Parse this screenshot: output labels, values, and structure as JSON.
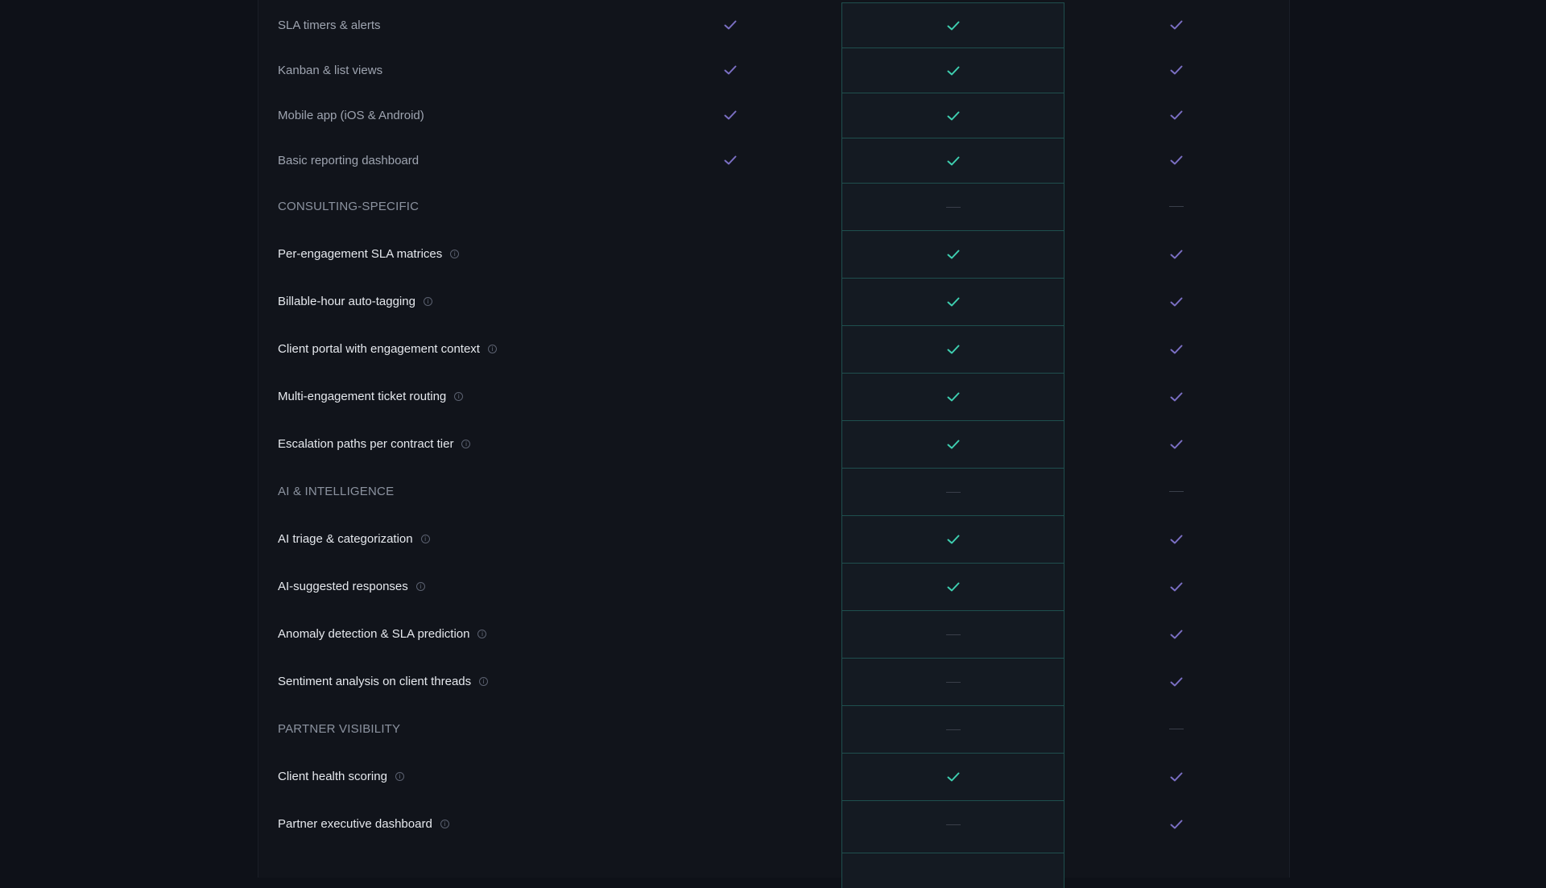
{
  "colors": {
    "accent_check": "#3ecfb0",
    "muted_check": "#7b6fc4",
    "highlight_border": "#1f4f4e"
  },
  "rows": [
    {
      "type": "basic",
      "label": "SLA timers & alerts",
      "info": false,
      "c1": "check",
      "c2": "check",
      "c3": "check"
    },
    {
      "type": "basic",
      "label": "Kanban & list views",
      "info": false,
      "c1": "check",
      "c2": "check",
      "c3": "check"
    },
    {
      "type": "basic",
      "label": "Mobile app (iOS & Android)",
      "info": false,
      "c1": "check",
      "c2": "check",
      "c3": "check"
    },
    {
      "type": "basic",
      "label": "Basic reporting dashboard",
      "info": false,
      "c1": "check",
      "c2": "check",
      "c3": "check"
    },
    {
      "type": "section",
      "label": "CONSULTING-SPECIFIC",
      "info": false,
      "c1": "dash",
      "c2": "dash",
      "c3": "dash"
    },
    {
      "type": "feature",
      "label": "Per-engagement SLA matrices",
      "info": true,
      "c1": "dash",
      "c2": "check",
      "c3": "check"
    },
    {
      "type": "feature",
      "label": "Billable-hour auto-tagging",
      "info": true,
      "c1": "dash",
      "c2": "check",
      "c3": "check"
    },
    {
      "type": "feature",
      "label": "Client portal with engagement context",
      "info": true,
      "c1": "dash",
      "c2": "check",
      "c3": "check"
    },
    {
      "type": "feature",
      "label": "Multi-engagement ticket routing",
      "info": true,
      "c1": "dash",
      "c2": "check",
      "c3": "check"
    },
    {
      "type": "feature",
      "label": "Escalation paths per contract tier",
      "info": true,
      "c1": "dash",
      "c2": "check",
      "c3": "check"
    },
    {
      "type": "section",
      "label": "AI & INTELLIGENCE",
      "info": false,
      "c1": "dash",
      "c2": "dash",
      "c3": "dash"
    },
    {
      "type": "feature",
      "label": "AI triage & categorization",
      "info": true,
      "c1": "dash",
      "c2": "check",
      "c3": "check"
    },
    {
      "type": "feature",
      "label": "AI-suggested responses",
      "info": true,
      "c1": "dash",
      "c2": "check",
      "c3": "check"
    },
    {
      "type": "feature",
      "label": "Anomaly detection & SLA prediction",
      "info": true,
      "c1": "dash",
      "c2": "dash",
      "c3": "check"
    },
    {
      "type": "feature",
      "label": "Sentiment analysis on client threads",
      "info": true,
      "c1": "dash",
      "c2": "dash",
      "c3": "check"
    },
    {
      "type": "section",
      "label": "PARTNER VISIBILITY",
      "info": false,
      "c1": "dash",
      "c2": "dash",
      "c3": "dash"
    },
    {
      "type": "feature",
      "label": "Client health scoring",
      "info": true,
      "c1": "dash",
      "c2": "check",
      "c3": "check"
    },
    {
      "type": "feature",
      "label": "Partner executive dashboard",
      "info": true,
      "c1": "dash",
      "c2": "dash",
      "c3": "check"
    }
  ]
}
